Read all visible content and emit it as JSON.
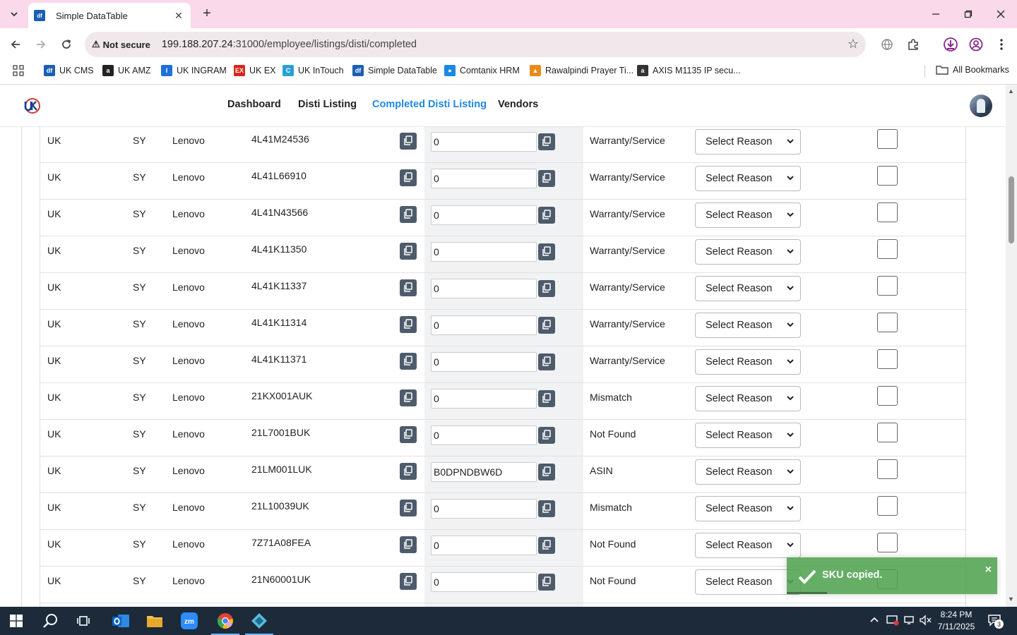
{
  "browser": {
    "tab_title": "Simple DataTable",
    "security_label": "Not secure",
    "url_host": "199.188.207.24",
    "url_path": ":31000/employee/listings/disti/completed",
    "bookmarks": [
      {
        "label": "UK CMS",
        "icon": "df",
        "color": "#1b5fb3"
      },
      {
        "label": "UK AMZ",
        "icon": "a",
        "color": "#222222"
      },
      {
        "label": "UK INGRAM",
        "icon": "I",
        "color": "#1e6fd9"
      },
      {
        "label": "UK EX",
        "icon": "EX",
        "color": "#d9261c"
      },
      {
        "label": "UK InTouch",
        "icon": "C",
        "color": "#2aa0d8"
      },
      {
        "label": "Simple DataTable",
        "icon": "df",
        "color": "#1b5fb3"
      },
      {
        "label": "Comtanix HRM",
        "icon": "●",
        "color": "#1e88e5"
      },
      {
        "label": "Rawalpindi Prayer Ti...",
        "icon": "▲",
        "color": "#e88b1b"
      },
      {
        "label": "AXIS M1135 IP secu...",
        "icon": "a",
        "color": "#333333"
      }
    ],
    "all_bookmarks": "All Bookmarks"
  },
  "app": {
    "nav": [
      {
        "label": "Dashboard",
        "active": false
      },
      {
        "label": "Disti Listing",
        "active": false
      },
      {
        "label": "Completed Disti Listing",
        "active": true
      },
      {
        "label": "Vendors",
        "active": false
      }
    ],
    "accent": "#1e88e5"
  },
  "rows": [
    {
      "region": "UK",
      "code": "SY",
      "brand": "Lenovo",
      "sku": "4L41M24536",
      "asin": "0",
      "status": "Warranty/Service",
      "reason": "Select Reason",
      "checked": false
    },
    {
      "region": "UK",
      "code": "SY",
      "brand": "Lenovo",
      "sku": "4L41L66910",
      "asin": "0",
      "status": "Warranty/Service",
      "reason": "Select Reason",
      "checked": false
    },
    {
      "region": "UK",
      "code": "SY",
      "brand": "Lenovo",
      "sku": "4L41N43566",
      "asin": "0",
      "status": "Warranty/Service",
      "reason": "Select Reason",
      "checked": false
    },
    {
      "region": "UK",
      "code": "SY",
      "brand": "Lenovo",
      "sku": "4L41K11350",
      "asin": "0",
      "status": "Warranty/Service",
      "reason": "Select Reason",
      "checked": false
    },
    {
      "region": "UK",
      "code": "SY",
      "brand": "Lenovo",
      "sku": "4L41K11337",
      "asin": "0",
      "status": "Warranty/Service",
      "reason": "Select Reason",
      "checked": false
    },
    {
      "region": "UK",
      "code": "SY",
      "brand": "Lenovo",
      "sku": "4L41K11314",
      "asin": "0",
      "status": "Warranty/Service",
      "reason": "Select Reason",
      "checked": false
    },
    {
      "region": "UK",
      "code": "SY",
      "brand": "Lenovo",
      "sku": "4L41K11371",
      "asin": "0",
      "status": "Warranty/Service",
      "reason": "Select Reason",
      "checked": false
    },
    {
      "region": "UK",
      "code": "SY",
      "brand": "Lenovo",
      "sku": "21KX001AUK",
      "asin": "0",
      "status": "Mismatch",
      "reason": "Select Reason",
      "checked": false
    },
    {
      "region": "UK",
      "code": "SY",
      "brand": "Lenovo",
      "sku": "21L7001BUK",
      "asin": "0",
      "status": "Not Found",
      "reason": "Select Reason",
      "checked": false
    },
    {
      "region": "UK",
      "code": "SY",
      "brand": "Lenovo",
      "sku": "21LM001LUK",
      "asin": "B0DPNDBW6D",
      "status": "ASIN",
      "reason": "Select Reason",
      "checked": false
    },
    {
      "region": "UK",
      "code": "SY",
      "brand": "Lenovo",
      "sku": "21L10039UK",
      "asin": "0",
      "status": "Mismatch",
      "reason": "Select Reason",
      "checked": false
    },
    {
      "region": "UK",
      "code": "SY",
      "brand": "Lenovo",
      "sku": "7Z71A08FEA",
      "asin": "0",
      "status": "Not Found",
      "reason": "Select Reason",
      "checked": false
    },
    {
      "region": "UK",
      "code": "SY",
      "brand": "Lenovo",
      "sku": "21N60001UK",
      "asin": "0",
      "status": "Not Found",
      "reason": "Select Reason",
      "checked": false
    }
  ],
  "toast": {
    "message": "SKU copied.",
    "close": "×",
    "color": "#51a351"
  },
  "taskbar": {
    "time": "8:24 PM",
    "date": "7/11/2025",
    "notifications": "3"
  }
}
